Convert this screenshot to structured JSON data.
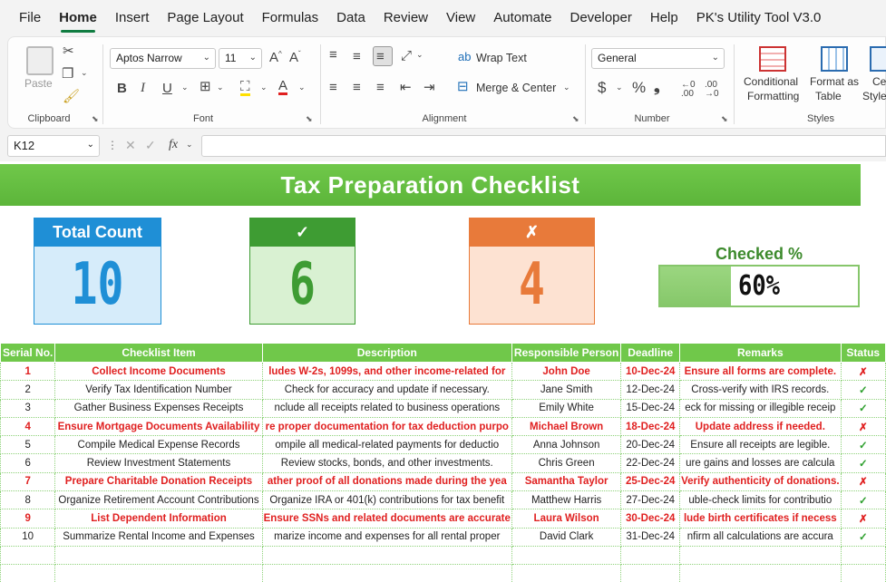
{
  "menu": [
    "File",
    "Home",
    "Insert",
    "Page Layout",
    "Formulas",
    "Data",
    "Review",
    "View",
    "Automate",
    "Developer",
    "Help",
    "PK's Utility Tool V3.0"
  ],
  "menu_active": "Home",
  "ribbon": {
    "clipboard": {
      "paste": "Paste",
      "label": "Clipboard"
    },
    "font": {
      "name": "Aptos Narrow",
      "size": "11",
      "label": "Font"
    },
    "alignment": {
      "wrap": "Wrap Text",
      "merge": "Merge & Center",
      "label": "Alignment"
    },
    "number": {
      "format": "General",
      "label": "Number"
    },
    "styles": {
      "conditional_1": "Conditional",
      "conditional_2": "Formatting",
      "format_table_1": "Format as",
      "format_table_2": "Table",
      "cell_1": "Cell",
      "cell_2": "Styles",
      "label": "Styles"
    }
  },
  "formula_bar": {
    "name_box": "K12",
    "fx": "fx",
    "content": ""
  },
  "sheet": {
    "title": "Tax Preparation Checklist",
    "cards": [
      {
        "head": "Total Count",
        "value": "10",
        "head_color": "#1f8fd6",
        "body_color": "#d6ecfa",
        "value_color": "#1f8fd6"
      },
      {
        "head": "✓",
        "value": "6",
        "head_color": "#3e9c33",
        "body_color": "#d9f1d2",
        "value_color": "#3e9c33"
      },
      {
        "head": "✗",
        "value": "4",
        "head_color": "#e87a3a",
        "body_color": "#fde2d2",
        "value_color": "#e87a3a"
      }
    ],
    "checked_label": "Checked %",
    "checked_value": "60%",
    "checked_fraction": 0.6,
    "headers": [
      "Serial No.",
      "Checklist Item",
      "Description",
      "Responsible Person",
      "Deadline",
      "Remarks",
      "Status"
    ],
    "rows": [
      {
        "no": "1",
        "item": "Collect Income Documents",
        "desc": "ludes W-2s, 1099s, and other income-related for",
        "person": "John Doe",
        "deadline": "10-Dec-24",
        "remarks": "Ensure all forms are complete.",
        "status": "✗",
        "flag": true
      },
      {
        "no": "2",
        "item": "Verify Tax Identification Number",
        "desc": "Check for accuracy and update if necessary.",
        "person": "Jane Smith",
        "deadline": "12-Dec-24",
        "remarks": "Cross-verify with IRS records.",
        "status": "✓",
        "flag": false
      },
      {
        "no": "3",
        "item": "Gather Business Expenses Receipts",
        "desc": "nclude all receipts related to business operations",
        "person": "Emily White",
        "deadline": "15-Dec-24",
        "remarks": "eck for missing or illegible receip",
        "status": "✓",
        "flag": false
      },
      {
        "no": "4",
        "item": "Ensure Mortgage Documents Availability",
        "desc": "re proper documentation for tax deduction purpo",
        "person": "Michael Brown",
        "deadline": "18-Dec-24",
        "remarks": "Update address if needed.",
        "status": "✗",
        "flag": true
      },
      {
        "no": "5",
        "item": "Compile Medical Expense Records",
        "desc": "ompile all medical-related payments for deductio",
        "person": "Anna Johnson",
        "deadline": "20-Dec-24",
        "remarks": "Ensure all receipts are legible.",
        "status": "✓",
        "flag": false
      },
      {
        "no": "6",
        "item": "Review Investment Statements",
        "desc": "Review stocks, bonds, and other investments.",
        "person": "Chris Green",
        "deadline": "22-Dec-24",
        "remarks": "ure gains and losses are calcula",
        "status": "✓",
        "flag": false
      },
      {
        "no": "7",
        "item": "Prepare Charitable Donation Receipts",
        "desc": "ather proof of all donations made during the yea",
        "person": "Samantha Taylor",
        "deadline": "25-Dec-24",
        "remarks": "Verify authenticity of donations.",
        "status": "✗",
        "flag": true
      },
      {
        "no": "8",
        "item": "Organize Retirement Account Contributions",
        "desc": "Organize IRA or 401(k) contributions for tax benefit",
        "person": "Matthew Harris",
        "deadline": "27-Dec-24",
        "remarks": "uble-check limits for contributio",
        "status": "✓",
        "flag": false
      },
      {
        "no": "9",
        "item": "List Dependent Information",
        "desc": "Ensure SSNs and related documents are accurate",
        "person": "Laura Wilson",
        "deadline": "30-Dec-24",
        "remarks": "lude birth certificates if necess",
        "status": "✗",
        "flag": true
      },
      {
        "no": "10",
        "item": "Summarize Rental Income and Expenses",
        "desc": "marize income and expenses for all rental proper",
        "person": "David Clark",
        "deadline": "31-Dec-24",
        "remarks": "nfirm all calculations are accura",
        "status": "✓",
        "flag": false
      }
    ]
  }
}
